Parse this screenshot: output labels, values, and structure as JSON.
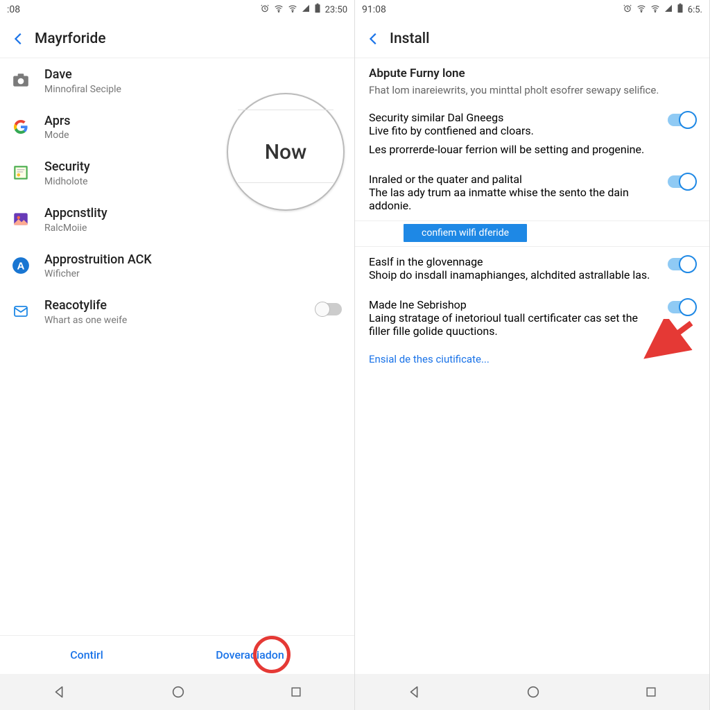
{
  "left": {
    "status": {
      "time": ":08",
      "clock": "23:50"
    },
    "title": "Mayrforide",
    "magnifier_text": "Now",
    "items": [
      {
        "primary": "Dave",
        "secondary": "Minnofiral Seciple",
        "icon": "camera"
      },
      {
        "primary": "Aprs",
        "secondary": "Mode",
        "icon": "google"
      },
      {
        "primary": "Security",
        "secondary": "Midholote",
        "icon": "cert"
      },
      {
        "primary": "Appcnstlity",
        "secondary": "RalcMoiie",
        "icon": "gallery"
      },
      {
        "primary": "Approstruition ACK",
        "secondary": "Wificher",
        "icon": "blue-a"
      },
      {
        "primary": "Reacotylife",
        "secondary": "Whart as one weife",
        "icon": "mail"
      }
    ],
    "footer": {
      "left": "Contirl",
      "right": "Doveradiadon"
    }
  },
  "right": {
    "status": {
      "time": "91:08",
      "clock": "6:5."
    },
    "title": "Install",
    "intro": {
      "title": "Abpute Furny lone",
      "body": "Fhat lom inareiewrits, you minttal pholt esofrer sewapy selifice."
    },
    "sections": [
      {
        "title": "Security similar Dal Gneegs",
        "body": "Live fito by contfiened and cloars.",
        "body2": "Les prorrerde-louar ferrion will be setting and progenine.",
        "toggle": true
      },
      {
        "title": "Inraled or the quater and palital",
        "body": "The las ady trum aa inmatte whise the sento the dain addonie.",
        "toggle": true
      },
      {
        "title": "Easlf in the glovennage",
        "body": "Shoip do insdall inamaphianges, alchdited astrallable las.",
        "toggle": true
      },
      {
        "title": "Made lne Sebrishop",
        "body": "Laing stratage of inetorioul tuall certificater cas set the filler fille golide quuctions.",
        "toggle": true
      }
    ],
    "highlight_chip": "confiem wilfi dferide",
    "link": "Ensial de thes ciutificate..."
  }
}
